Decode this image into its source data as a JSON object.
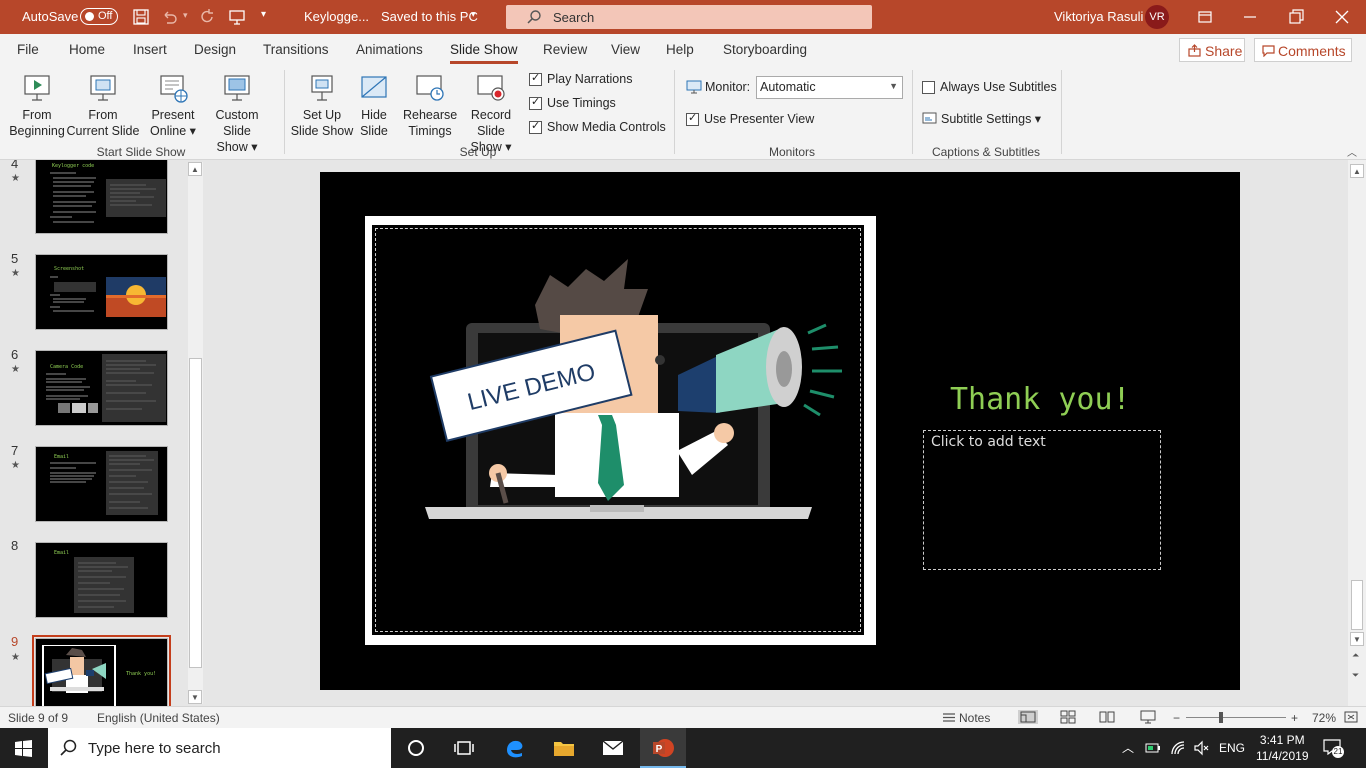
{
  "titlebar": {
    "autosave_label": "AutoSave",
    "autosave_state": "Off",
    "doc_name": "Keylogge...",
    "save_status": "Saved to this PC",
    "search_placeholder": "Search",
    "user_name": "Viktoriya Rasuli",
    "user_initials": "VR",
    "accent_color": "#b7472a"
  },
  "tabs": {
    "items": [
      "File",
      "Home",
      "Insert",
      "Design",
      "Transitions",
      "Animations",
      "Slide Show",
      "Review",
      "View",
      "Help",
      "Storyboarding"
    ],
    "active": "Slide Show",
    "share_label": "Share",
    "comments_label": "Comments"
  },
  "ribbon": {
    "start": {
      "from_beginning": [
        "From",
        "Beginning"
      ],
      "from_current": [
        "From",
        "Current Slide"
      ],
      "present_online": [
        "Present",
        "Online ▾"
      ],
      "custom_show": [
        "Custom Slide",
        "Show ▾"
      ],
      "group_label": "Start Slide Show"
    },
    "setup": {
      "setup_show": [
        "Set Up",
        "Slide Show"
      ],
      "hide_slide": [
        "Hide",
        "Slide"
      ],
      "rehearse": [
        "Rehearse",
        "Timings"
      ],
      "record": [
        "Record Slide",
        "Show ▾"
      ],
      "play_narrations": "Play Narrations",
      "use_timings": "Use Timings",
      "show_media_controls": "Show Media Controls",
      "group_label": "Set Up"
    },
    "monitors": {
      "monitor_label": "Monitor:",
      "monitor_value": "Automatic",
      "presenter_view": "Use Presenter View",
      "group_label": "Monitors"
    },
    "captions": {
      "always_subtitles": "Always Use Subtitles",
      "subtitle_settings": "Subtitle Settings ▾",
      "group_label": "Captions & Subtitles"
    }
  },
  "thumbnails": {
    "slides": [
      {
        "num": "4",
        "title": "Keylogger code"
      },
      {
        "num": "5",
        "title": "Screenshot"
      },
      {
        "num": "6",
        "title": "Camera Code"
      },
      {
        "num": "7",
        "title": "Email"
      },
      {
        "num": "8",
        "title": "Email"
      },
      {
        "num": "9",
        "title": "Thank you!"
      }
    ],
    "selected": "9",
    "star": "★"
  },
  "slide": {
    "sign_text": "LIVE DEMO",
    "thank_you": "Thank you!",
    "placeholder": "Click to add text",
    "thank_color": "#8fce54"
  },
  "statusbar": {
    "slide_count": "Slide 9 of 9",
    "language": "English (United States)",
    "notes": "Notes",
    "zoom_minus": "−",
    "zoom_plus": "+",
    "zoom_level": "72%"
  },
  "taskbar": {
    "search_placeholder": "Type here to search",
    "language": "ENG",
    "time": "3:41 PM",
    "date": "11/4/2019",
    "notification_count": "21"
  }
}
